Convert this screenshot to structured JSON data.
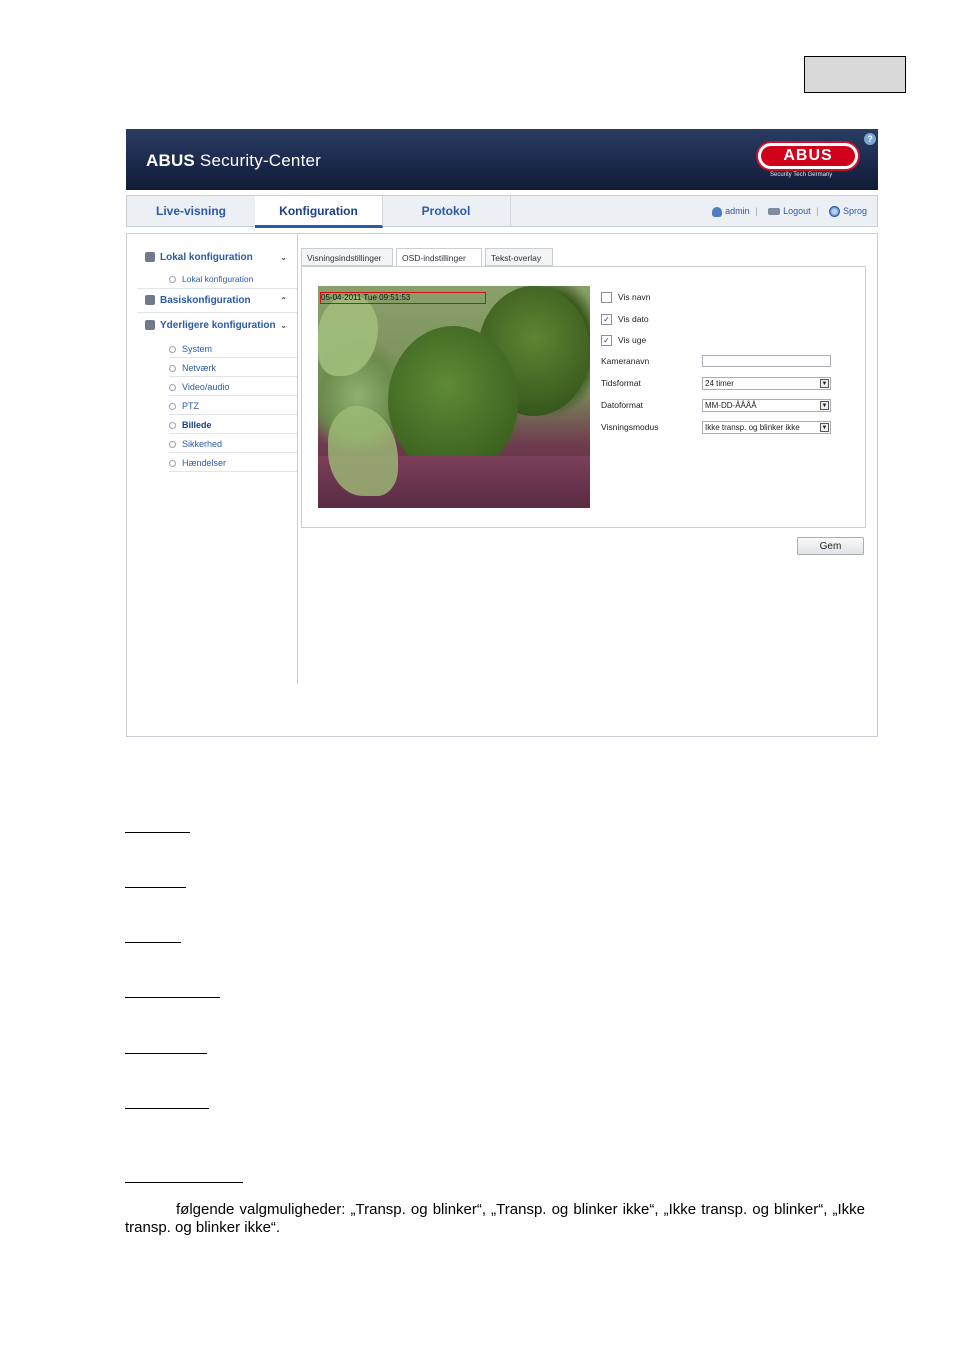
{
  "banner": {
    "brand_bold": "ABUS",
    "brand_rest": " Security-Center",
    "logo_text": "ABUS",
    "logo_sub": "Security Tech Germany",
    "help_glyph": "?"
  },
  "nav": {
    "tabs": [
      "Live-visning",
      "Konfiguration",
      "Protokol"
    ],
    "active_tab": "Konfiguration",
    "user": "admin",
    "logout": "Logout",
    "language": "Sprog"
  },
  "sidebar": {
    "local_head": "Lokal konfiguration",
    "local_sub": "Lokal konfiguration",
    "basic_head": "Basiskonfiguration",
    "adv_head": "Yderligere konfiguration",
    "items": [
      "System",
      "Netværk",
      "Video/audio",
      "PTZ",
      "Billede",
      "Sikkerhed",
      "Hændelser"
    ],
    "active_item": "Billede"
  },
  "subtabs": [
    "Visningsindstillinger",
    "OSD-indstillinger",
    "Tekst-overlay"
  ],
  "active_subtab": "OSD-indstillinger",
  "preview": {
    "osd_text": "05-04-2011 Tue 09:51:53"
  },
  "form": {
    "vis_navn": {
      "label": "Vis navn",
      "checked": false
    },
    "vis_dato": {
      "label": "Vis dato",
      "checked": true
    },
    "vis_uge": {
      "label": "Vis uge",
      "checked": true
    },
    "kameranavn_label": "Kameranavn",
    "kameranavn_value": "",
    "tidsformat_label": "Tidsformat",
    "tidsformat_value": "24 timer",
    "datoformat_label": "Datoformat",
    "datoformat_value": "MM-DD-ÅÅÅÅ",
    "visningsmodus_label": "Visningsmodus",
    "visningsmodus_value": "Ikke transp. og blinker ikke"
  },
  "save_button": "Gem",
  "document": {
    "paragraph": "følgende valgmuligheder: „Transp. og blinker“, „Transp. og blinker ikke“, „Ikke transp. og blinker“, „Ikke transp. og blinker ikke“."
  }
}
